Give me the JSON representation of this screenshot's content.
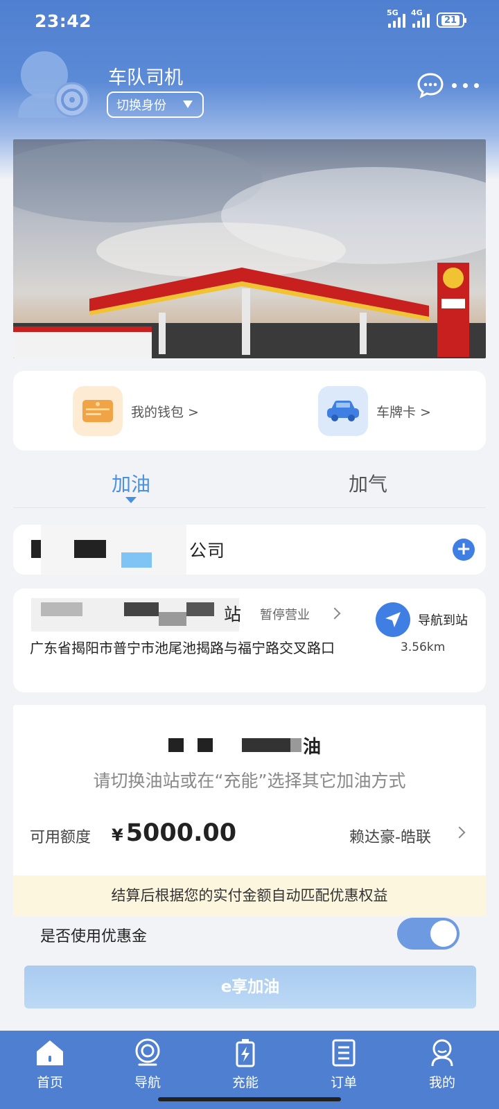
{
  "status_bar": {
    "time": "23:42",
    "network_1": "5G",
    "network_2": "4G",
    "battery": "21"
  },
  "header": {
    "user_title": "车队司机",
    "switch_label": "切换身份"
  },
  "quick_links": {
    "wallet_label": "我的钱包 >",
    "plate_card_label": "车牌卡 >"
  },
  "tabs": {
    "fuel": "加油",
    "gas": "加气"
  },
  "company": {
    "name_suffix": "公司"
  },
  "station": {
    "name_suffix": "站",
    "status": "暂停营业",
    "address": "广东省揭阳市普宁市池尾池揭路与福宁路交叉路口",
    "nav_label": "导航到站",
    "distance": "3.56km"
  },
  "panel": {
    "title_suffix": "油",
    "subtitle": "请切换油站或在“充能”选择其它加油方式",
    "quota_label": "可用额度",
    "currency": "¥",
    "quota_value": "5000.00",
    "account": "赖达豪-皓联",
    "promo": "结算后根据您的实付金额自动匹配优惠权益",
    "coupon_label": "是否使用优惠金",
    "coupon_enabled": true,
    "action_button": "e享加油"
  },
  "bottom_nav": [
    {
      "label": "首页",
      "icon": "home-icon"
    },
    {
      "label": "导航",
      "icon": "navigation-icon"
    },
    {
      "label": "充能",
      "icon": "energy-icon"
    },
    {
      "label": "订单",
      "icon": "order-icon"
    },
    {
      "label": "我的",
      "icon": "profile-icon"
    }
  ],
  "colors": {
    "primary": "#4f7fd0",
    "accent": "#4a90e2",
    "button_disabled": "#b4d3f3",
    "promo_bg": "#fdf6de"
  }
}
